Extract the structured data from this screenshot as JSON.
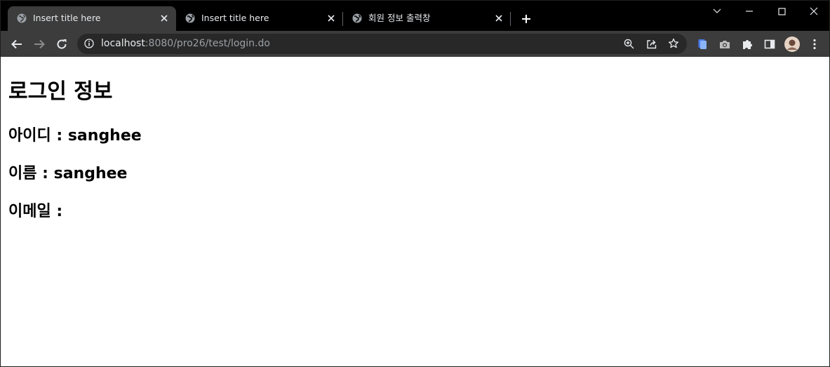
{
  "tabs": [
    {
      "title": "Insert title here",
      "active": true
    },
    {
      "title": "Insert title here",
      "active": false
    },
    {
      "title": "회원 정보 출력창",
      "active": false
    }
  ],
  "toolbar": {
    "url_host": "localhost",
    "url_rest": ":8080/pro26/test/login.do"
  },
  "page": {
    "heading": "로그인 정보",
    "id_line": "아이디 : sanghee",
    "name_line": "이름 : sanghee",
    "email_line": "이메일 :"
  },
  "colors": {
    "tabstrip_bg": "#000000",
    "active_tab_bg": "#3c3c3c",
    "toolbar_bg": "#3c3c3c",
    "omnibox_bg": "#282828",
    "page_bg": "#ffffff",
    "tab_text": "#e8eaed"
  }
}
